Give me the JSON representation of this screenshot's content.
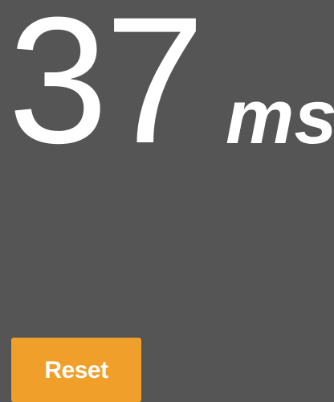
{
  "reading": {
    "value": "37",
    "unit": "ms"
  },
  "controls": {
    "reset_label": "Reset"
  },
  "colors": {
    "background": "#555555",
    "text": "#ffffff",
    "accent": "#f0a02a"
  }
}
